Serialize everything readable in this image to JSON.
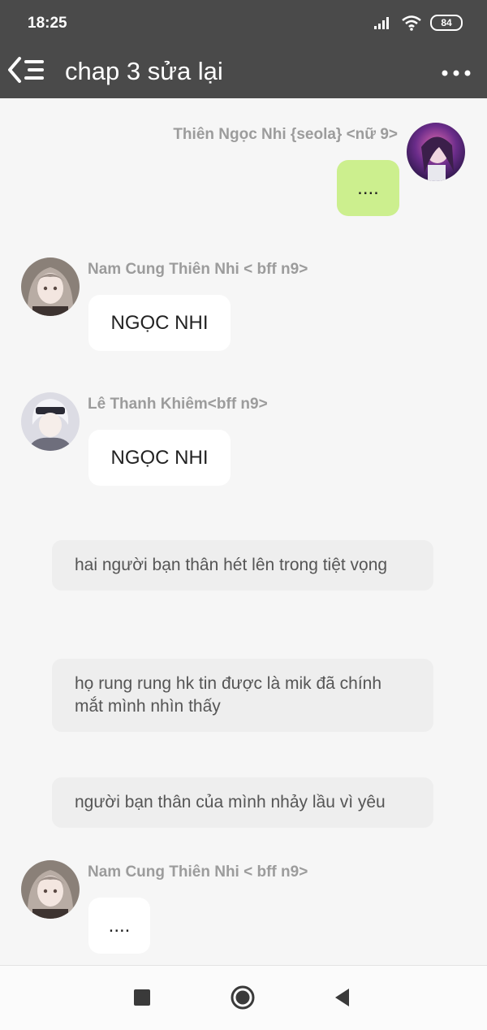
{
  "status_bar": {
    "time": "18:25",
    "battery": "84",
    "icons": [
      "signal-icon",
      "wifi-icon",
      "battery-icon"
    ]
  },
  "app_bar": {
    "title": "chap 3 sửa lại",
    "back_icon": "back-menu-icon",
    "more_icon": "more-options-icon"
  },
  "messages": [
    {
      "sender": "Thiên Ngọc Nhi {seola} <nữ 9>",
      "text": "....",
      "side": "right"
    },
    {
      "sender": "Nam Cung Thiên Nhi < bff n9>",
      "text": "NGỌC NHI",
      "side": "left"
    },
    {
      "sender": "Lê Thanh Khiêm<bff n9>",
      "text": "NGỌC NHI",
      "side": "left"
    },
    {
      "sender": "Nam Cung Thiên Nhi < bff n9>",
      "text": "....",
      "side": "left"
    }
  ],
  "narrations": [
    "hai người bạn thân hét lên trong tiệt vọng",
    "họ rung rung hk tin được là mik đã chính mắt mình nhìn thấy",
    "người bạn thân của mình nhảy lầu vì yêu"
  ],
  "nav_bar": {
    "icons": [
      "recents-square-icon",
      "home-circle-icon",
      "back-triangle-icon"
    ]
  },
  "colors": {
    "header": "#4a4a4a",
    "own_bubble": "#ccef8e",
    "other_bubble": "#ffffff",
    "narration_bg": "#eeeeee",
    "background": "#f6f6f6"
  }
}
